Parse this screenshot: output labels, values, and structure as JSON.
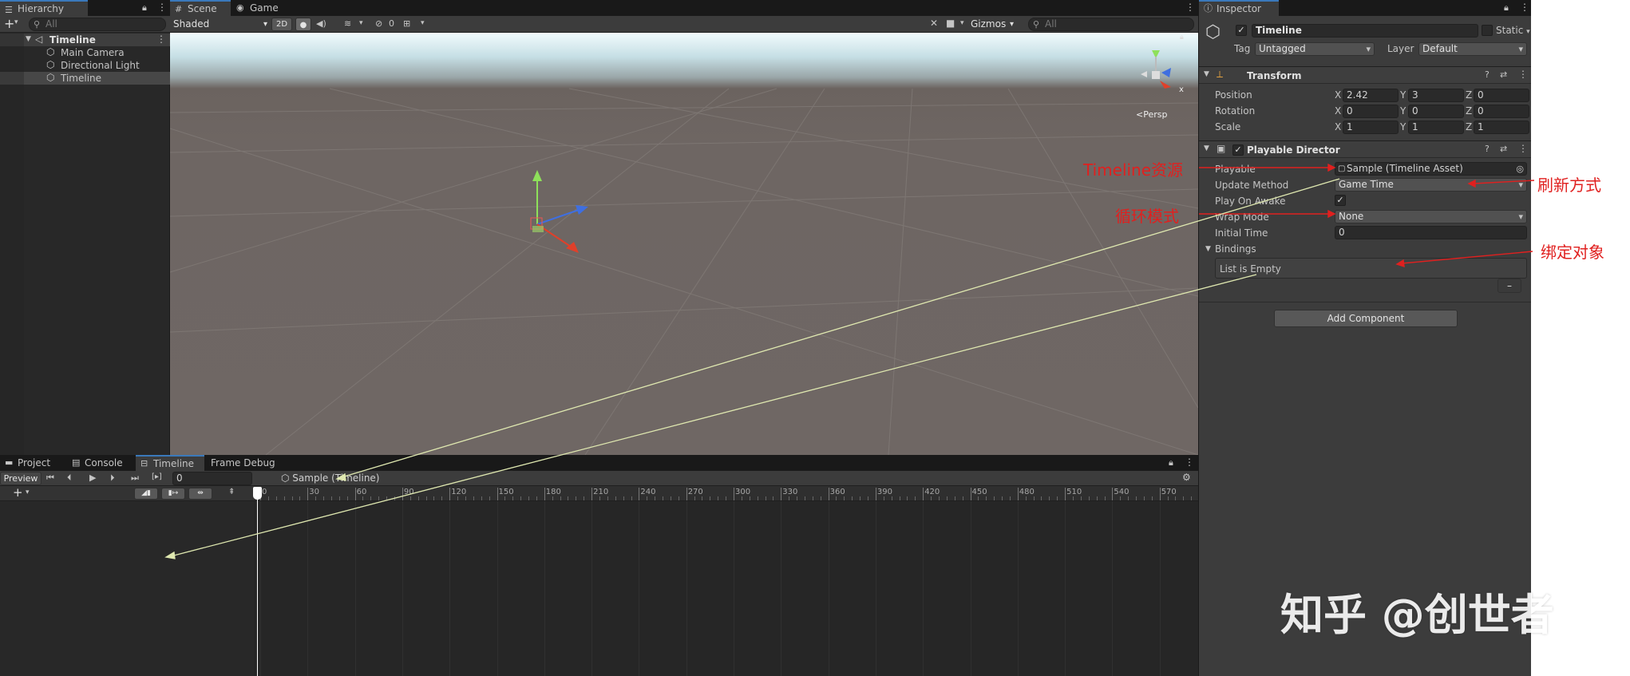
{
  "hierarchy": {
    "tab_label": "Hierarchy",
    "search_placeholder": "All",
    "scene_name": "Timeline",
    "items": [
      {
        "label": "Main Camera"
      },
      {
        "label": "Directional Light"
      },
      {
        "label": "Timeline"
      }
    ]
  },
  "scene_view": {
    "tabs": [
      {
        "label": "Scene"
      },
      {
        "label": "Game"
      }
    ],
    "shading_mode": "Shaded",
    "mode_2d": "2D",
    "hidden_count": "0",
    "gizmos_label": "Gizmos",
    "search_placeholder": "All",
    "persp_label": "Persp",
    "axis_x_label": "x"
  },
  "bottom": {
    "tabs": [
      {
        "label": "Project"
      },
      {
        "label": "Console"
      },
      {
        "label": "Timeline"
      },
      {
        "label": "Frame Debug"
      }
    ],
    "preview_label": "Preview",
    "frame_value": "0",
    "asset_breadcrumb": "Sample (Timeline)",
    "ruler_ticks": [
      "0",
      "30",
      "60",
      "90",
      "120",
      "150",
      "180",
      "210",
      "240",
      "270",
      "300",
      "330",
      "360",
      "390",
      "420",
      "450",
      "480",
      "510",
      "540",
      "570"
    ]
  },
  "inspector": {
    "tab_label": "Inspector",
    "object_name": "Timeline",
    "static_label": "Static",
    "tag_label": "Tag",
    "tag_value": "Untagged",
    "layer_label": "Layer",
    "layer_value": "Default",
    "transform": {
      "title": "Transform",
      "rows": [
        {
          "label": "Position",
          "x": "2.42",
          "y": "3",
          "z": "0"
        },
        {
          "label": "Rotation",
          "x": "0",
          "y": "0",
          "z": "0"
        },
        {
          "label": "Scale",
          "x": "1",
          "y": "1",
          "z": "1"
        }
      ]
    },
    "playable_director": {
      "title": "Playable Director",
      "playable_label": "Playable",
      "playable_value": "Sample (Timeline Asset)",
      "update_method_label": "Update Method",
      "update_method_value": "Game Time",
      "play_on_awake_label": "Play On Awake",
      "wrap_mode_label": "Wrap Mode",
      "wrap_mode_value": "None",
      "initial_time_label": "Initial Time",
      "initial_time_value": "0",
      "bindings_label": "Bindings",
      "bindings_empty": "List is Empty",
      "remove_label": "–"
    },
    "add_component": "Add Component"
  },
  "annotations": {
    "timeline_asset": "Timeline资源",
    "update_mode": "刷新方式",
    "loop_mode": "循环模式",
    "bind_object": "绑定对象",
    "accent_color": "#e0201f",
    "line_color": "#dfe8b0"
  },
  "watermark": "知乎 @创世者"
}
